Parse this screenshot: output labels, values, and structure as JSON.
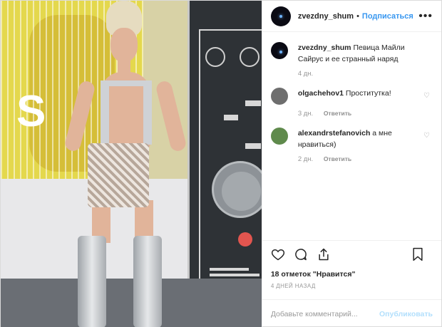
{
  "post": {
    "username": "zvezdny_shum",
    "separator": "•",
    "follow_label": "Подписаться",
    "more_icon": "more-horizontal-icon"
  },
  "comments": [
    {
      "username": "zvezdny_shum",
      "text": "Певица Майли Сайрус и ее странный наряд",
      "time": "4 дн.",
      "reply_label": ""
    },
    {
      "username": "olgachehov1",
      "text": "Проститутка!",
      "time": "3 дн.",
      "reply_label": "Ответить"
    },
    {
      "username": "alexandrstefanovich",
      "text": "а мне нравиться)",
      "time": "2 дн.",
      "reply_label": "Ответить"
    }
  ],
  "actions": {
    "like_icon": "heart-icon",
    "comment_icon": "comment-icon",
    "share_icon": "share-icon",
    "save_icon": "bookmark-icon"
  },
  "likes_text": "18 отметок \"Нравится\"",
  "posted_ago": "4 ДНЕЙ НАЗАД",
  "add_comment": {
    "placeholder": "Добавьте комментарий...",
    "publish_label": "Опубликовать"
  },
  "photo": {
    "sign_letter": "S"
  }
}
